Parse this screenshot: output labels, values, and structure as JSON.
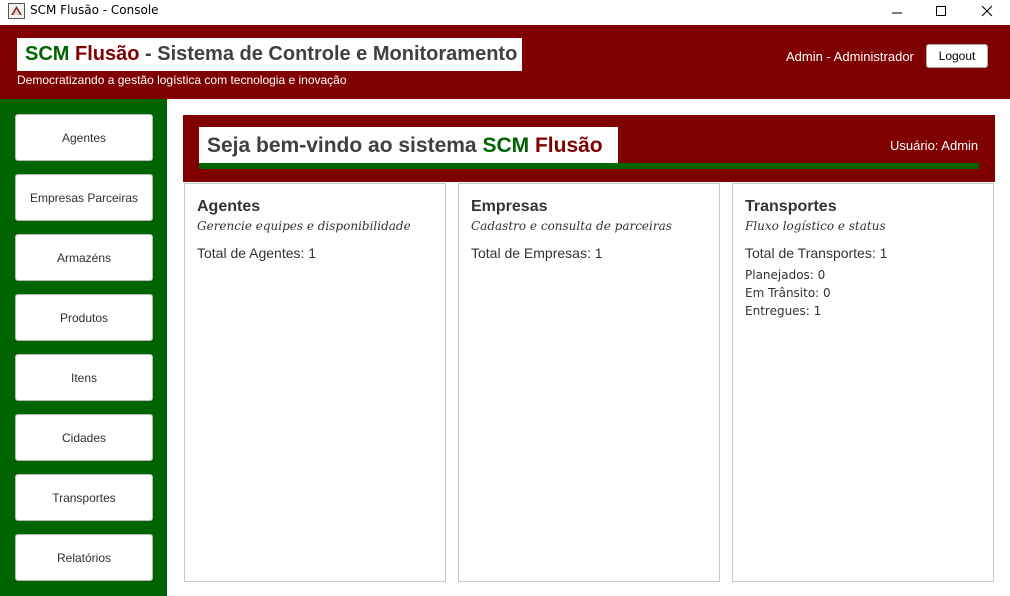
{
  "window": {
    "title": "SCM Flusão - Console",
    "icon": "java-app-icon"
  },
  "header": {
    "brand_scm": "SCM",
    "brand_flusao": "Flusão",
    "brand_rest": " - Sistema de Controle e Monitoramento",
    "tagline": "Democratizando a gestão logística com tecnologia e inovação",
    "user": "Admin - Administrador",
    "logout_label": "Logout"
  },
  "sidebar": {
    "items": [
      {
        "label": "Agentes"
      },
      {
        "label": "Empresas Parceiras"
      },
      {
        "label": "Armazéns"
      },
      {
        "label": "Produtos"
      },
      {
        "label": "Itens"
      },
      {
        "label": "Cidades"
      },
      {
        "label": "Transportes"
      },
      {
        "label": "Relatórios"
      }
    ]
  },
  "welcome": {
    "prefix": "Seja bem-vindo ao sistema ",
    "scm": "SCM",
    "flusao": "Flusão",
    "user_info": "Usuário: Admin"
  },
  "cards": [
    {
      "title": "Agentes",
      "subtitle": "Gerencie equipes e disponibilidade",
      "total": "Total de Agentes: 1"
    },
    {
      "title": "Empresas",
      "subtitle": "Cadastro e consulta de parceiras",
      "total": "Total de Empresas: 1"
    },
    {
      "title": "Transportes",
      "subtitle": "Fluxo logístico e status",
      "total": "Total de Transportes: 1",
      "stats": [
        "Planejados: 0",
        "Em Trânsito: 0",
        "Entregues: 1"
      ]
    }
  ],
  "colors": {
    "primary_red": "#800000",
    "primary_green": "#006400"
  }
}
